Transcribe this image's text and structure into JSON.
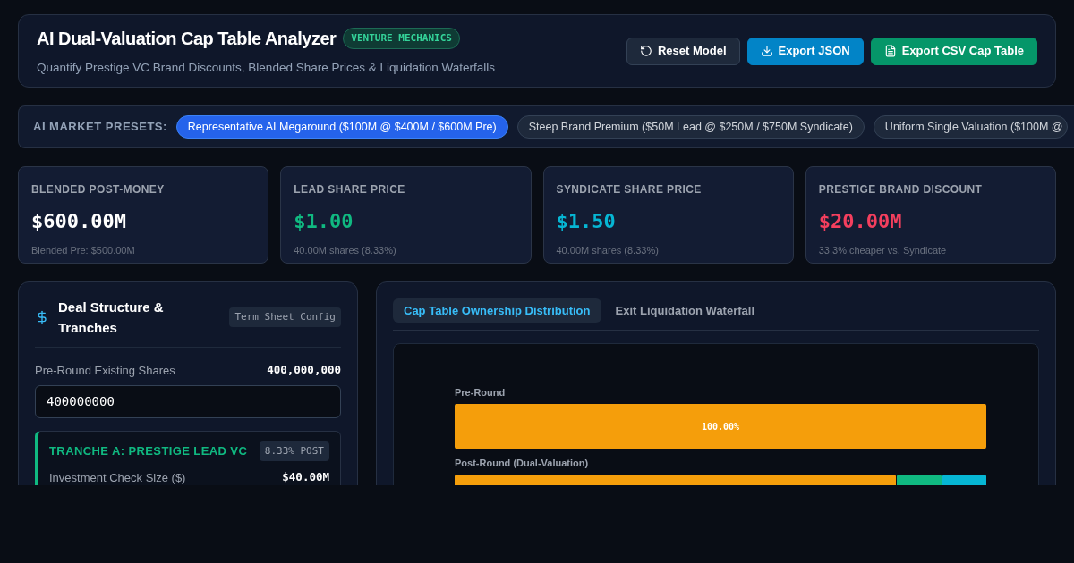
{
  "header": {
    "title": "AI Dual-Valuation Cap Table Analyzer",
    "badge": "VENTURE MECHANICS",
    "subtitle": "Quantify Prestige VC Brand Discounts, Blended Share Prices & Liquidation Waterfalls",
    "buttons": [
      {
        "kind": "reset",
        "label": "Reset Model"
      },
      {
        "kind": "json",
        "label": "Export JSON"
      },
      {
        "kind": "csv",
        "label": "Export CSV Cap Table"
      }
    ]
  },
  "presets": {
    "label": "AI MARKET PRESETS:",
    "items": [
      {
        "label": "Representative AI Megaround ($100M @ $400M / $600M Pre)",
        "selected": true
      },
      {
        "label": "Steep Brand Premium ($50M Lead @ $250M / $750M Syndicate)",
        "selected": false
      },
      {
        "label": "Uniform Single Valuation ($100M @",
        "selected": false
      }
    ]
  },
  "stats": [
    {
      "label": "BLENDED POST-MONEY",
      "value": "$600.00M",
      "note": "Blended Pre: $500.00M",
      "color": "#ffffff"
    },
    {
      "label": "LEAD SHARE PRICE",
      "value": "$1.00",
      "note": "40.00M shares (8.33%)",
      "color": "#10b981"
    },
    {
      "label": "SYNDICATE SHARE PRICE",
      "value": "$1.50",
      "note": "40.00M shares (8.33%)",
      "color": "#06b6d4"
    },
    {
      "label": "PRESTIGE BRAND DISCOUNT",
      "value": "$20.00M",
      "note": "33.3% cheaper vs. Syndicate",
      "color": "#f43f5e"
    }
  ],
  "deal": {
    "title": "Deal Structure & Tranches",
    "tag": "Term Sheet Config",
    "pre_shares_label": "Pre-Round Existing Shares",
    "pre_shares_display": "400,000,000",
    "pre_shares_value": "400000000",
    "tranche": {
      "title": "TRANCHE A: PRESTIGE LEAD VC",
      "badge": "8.33% POST",
      "field_label": "Investment Check Size ($)",
      "field_value": "$40.00M"
    }
  },
  "tabs": [
    {
      "label": "Cap Table Ownership Distribution",
      "selected": true
    },
    {
      "label": "Exit Liquidation Waterfall",
      "selected": false
    }
  ],
  "ownership_bars": [
    {
      "label": "Pre-Round",
      "segments": [
        {
          "color": "#f59e0b",
          "text": "100.00%"
        }
      ]
    },
    {
      "label": "Post-Round (Dual-Valuation)",
      "segments": [
        {
          "color": "#f59e0b"
        },
        {
          "color": "#10b981"
        },
        {
          "color": "#06b6d4"
        }
      ]
    }
  ]
}
